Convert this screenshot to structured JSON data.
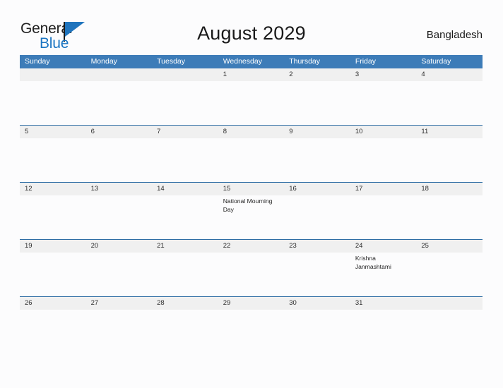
{
  "brand": {
    "name_top": "General",
    "name_bottom": "Blue",
    "accent_color": "#1f74bd"
  },
  "header": {
    "title": "August 2029",
    "country": "Bangladesh"
  },
  "calendar": {
    "header_color": "#3d7cb8",
    "rule_color": "#2e6da4",
    "daynum_band_color": "#f0f0f0",
    "weekdays": [
      "Sunday",
      "Monday",
      "Tuesday",
      "Wednesday",
      "Thursday",
      "Friday",
      "Saturday"
    ],
    "weeks": [
      {
        "days": [
          {
            "date": "",
            "event": ""
          },
          {
            "date": "",
            "event": ""
          },
          {
            "date": "",
            "event": ""
          },
          {
            "date": "1",
            "event": ""
          },
          {
            "date": "2",
            "event": ""
          },
          {
            "date": "3",
            "event": ""
          },
          {
            "date": "4",
            "event": ""
          }
        ]
      },
      {
        "days": [
          {
            "date": "5",
            "event": ""
          },
          {
            "date": "6",
            "event": ""
          },
          {
            "date": "7",
            "event": ""
          },
          {
            "date": "8",
            "event": ""
          },
          {
            "date": "9",
            "event": ""
          },
          {
            "date": "10",
            "event": ""
          },
          {
            "date": "11",
            "event": ""
          }
        ]
      },
      {
        "days": [
          {
            "date": "12",
            "event": ""
          },
          {
            "date": "13",
            "event": ""
          },
          {
            "date": "14",
            "event": ""
          },
          {
            "date": "15",
            "event": "National Mourning Day"
          },
          {
            "date": "16",
            "event": ""
          },
          {
            "date": "17",
            "event": ""
          },
          {
            "date": "18",
            "event": ""
          }
        ]
      },
      {
        "days": [
          {
            "date": "19",
            "event": ""
          },
          {
            "date": "20",
            "event": ""
          },
          {
            "date": "21",
            "event": ""
          },
          {
            "date": "22",
            "event": ""
          },
          {
            "date": "23",
            "event": ""
          },
          {
            "date": "24",
            "event": "Krishna Janmashtami"
          },
          {
            "date": "25",
            "event": ""
          }
        ]
      },
      {
        "days": [
          {
            "date": "26",
            "event": ""
          },
          {
            "date": "27",
            "event": ""
          },
          {
            "date": "28",
            "event": ""
          },
          {
            "date": "29",
            "event": ""
          },
          {
            "date": "30",
            "event": ""
          },
          {
            "date": "31",
            "event": ""
          },
          {
            "date": "",
            "event": ""
          }
        ]
      }
    ]
  }
}
